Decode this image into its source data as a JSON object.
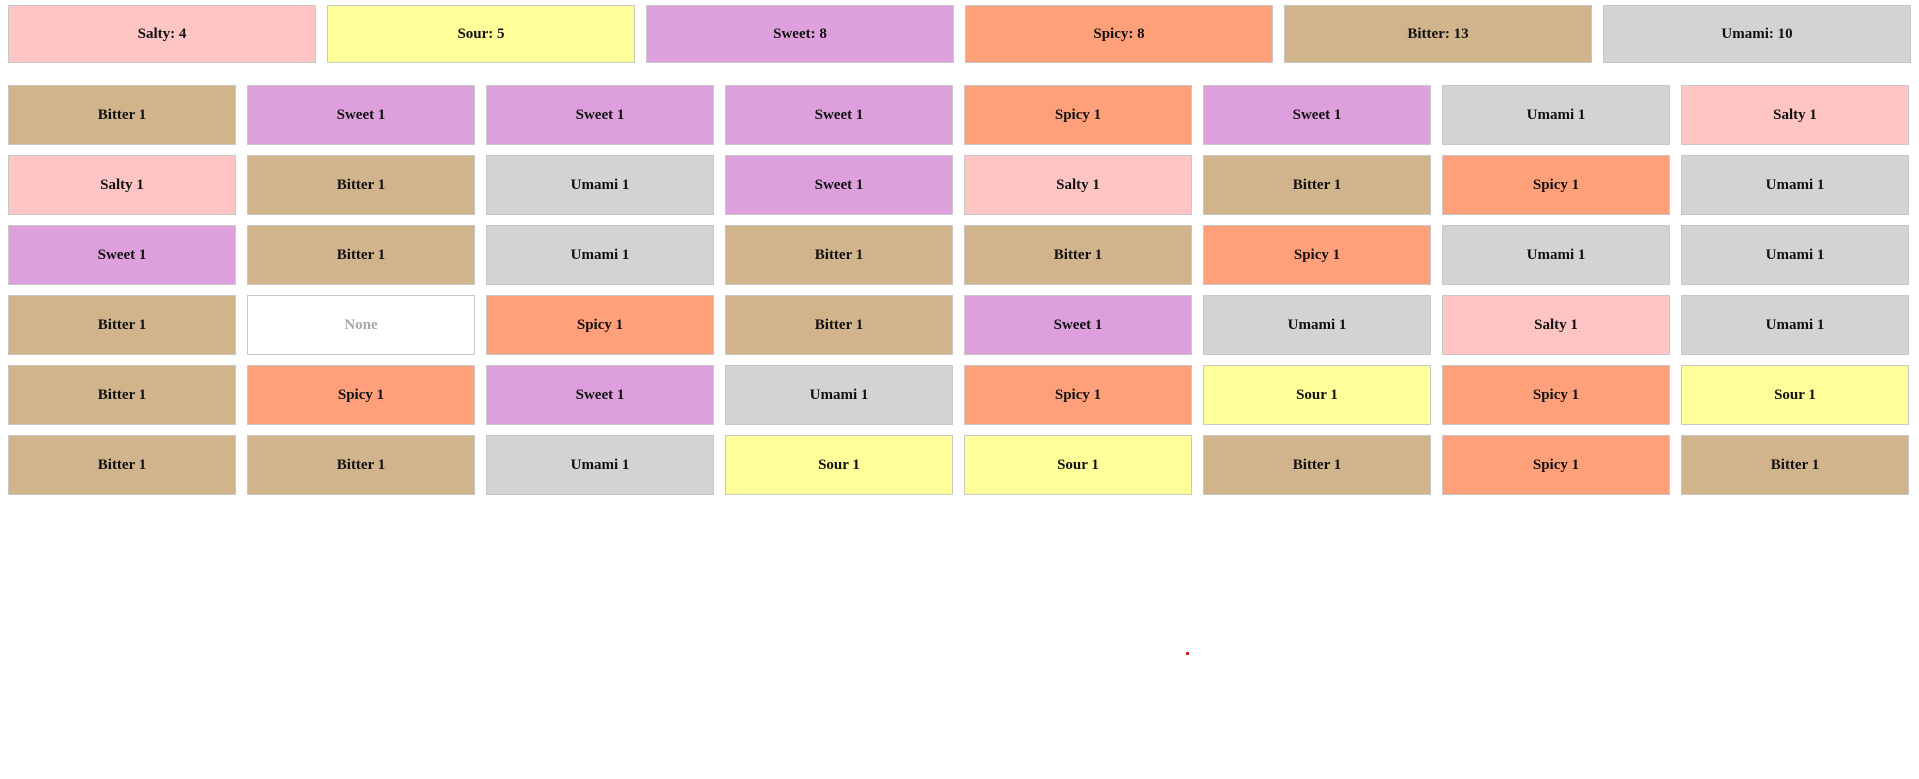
{
  "colors": {
    "Salty": "#ffc4c4",
    "Sour": "#ffff99",
    "Sweet": "#dda0dd",
    "Spicy": "#ffa07a",
    "Bitter": "#d2b48c",
    "Umami": "#d3d3d3",
    "None": "#ffffff",
    "cursor": "#e00000"
  },
  "summary": [
    {
      "flavor": "Salty",
      "label": "Salty: 4"
    },
    {
      "flavor": "Sour",
      "label": "Sour: 5"
    },
    {
      "flavor": "Sweet",
      "label": "Sweet: 8"
    },
    {
      "flavor": "Spicy",
      "label": "Spicy: 8"
    },
    {
      "flavor": "Bitter",
      "label": "Bitter: 13"
    },
    {
      "flavor": "Umami",
      "label": "Umami: 10"
    }
  ],
  "board": [
    [
      {
        "flavor": "Bitter",
        "label": "Bitter 1"
      },
      {
        "flavor": "Sweet",
        "label": "Sweet 1"
      },
      {
        "flavor": "Sweet",
        "label": "Sweet 1"
      },
      {
        "flavor": "Sweet",
        "label": "Sweet 1"
      },
      {
        "flavor": "Spicy",
        "label": "Spicy 1"
      },
      {
        "flavor": "Sweet",
        "label": "Sweet 1"
      },
      {
        "flavor": "Umami",
        "label": "Umami 1"
      },
      {
        "flavor": "Salty",
        "label": "Salty 1"
      }
    ],
    [
      {
        "flavor": "Salty",
        "label": "Salty 1"
      },
      {
        "flavor": "Bitter",
        "label": "Bitter 1"
      },
      {
        "flavor": "Umami",
        "label": "Umami 1"
      },
      {
        "flavor": "Sweet",
        "label": "Sweet 1"
      },
      {
        "flavor": "Salty",
        "label": "Salty 1"
      },
      {
        "flavor": "Bitter",
        "label": "Bitter 1"
      },
      {
        "flavor": "Spicy",
        "label": "Spicy 1"
      },
      {
        "flavor": "Umami",
        "label": "Umami 1"
      }
    ],
    [
      {
        "flavor": "Sweet",
        "label": "Sweet 1"
      },
      {
        "flavor": "Bitter",
        "label": "Bitter 1"
      },
      {
        "flavor": "Umami",
        "label": "Umami 1"
      },
      {
        "flavor": "Bitter",
        "label": "Bitter 1"
      },
      {
        "flavor": "Bitter",
        "label": "Bitter 1"
      },
      {
        "flavor": "Spicy",
        "label": "Spicy 1"
      },
      {
        "flavor": "Umami",
        "label": "Umami 1"
      },
      {
        "flavor": "Umami",
        "label": "Umami 1"
      }
    ],
    [
      {
        "flavor": "Bitter",
        "label": "Bitter 1"
      },
      {
        "flavor": "None",
        "label": "None"
      },
      {
        "flavor": "Spicy",
        "label": "Spicy 1"
      },
      {
        "flavor": "Bitter",
        "label": "Bitter 1"
      },
      {
        "flavor": "Sweet",
        "label": "Sweet 1"
      },
      {
        "flavor": "Umami",
        "label": "Umami 1"
      },
      {
        "flavor": "Salty",
        "label": "Salty 1"
      },
      {
        "flavor": "Umami",
        "label": "Umami 1"
      }
    ],
    [
      {
        "flavor": "Bitter",
        "label": "Bitter 1"
      },
      {
        "flavor": "Spicy",
        "label": "Spicy 1"
      },
      {
        "flavor": "Sweet",
        "label": "Sweet 1"
      },
      {
        "flavor": "Umami",
        "label": "Umami 1"
      },
      {
        "flavor": "Spicy",
        "label": "Spicy 1"
      },
      {
        "flavor": "Sour",
        "label": "Sour 1"
      },
      {
        "flavor": "Spicy",
        "label": "Spicy 1"
      },
      {
        "flavor": "Sour",
        "label": "Sour 1"
      }
    ],
    [
      {
        "flavor": "Bitter",
        "label": "Bitter 1"
      },
      {
        "flavor": "Bitter",
        "label": "Bitter 1"
      },
      {
        "flavor": "Umami",
        "label": "Umami 1"
      },
      {
        "flavor": "Sour",
        "label": "Sour 1"
      },
      {
        "flavor": "Sour",
        "label": "Sour 1"
      },
      {
        "flavor": "Bitter",
        "label": "Bitter 1"
      },
      {
        "flavor": "Spicy",
        "label": "Spicy 1"
      },
      {
        "flavor": "Bitter",
        "label": "Bitter 1"
      }
    ]
  ]
}
